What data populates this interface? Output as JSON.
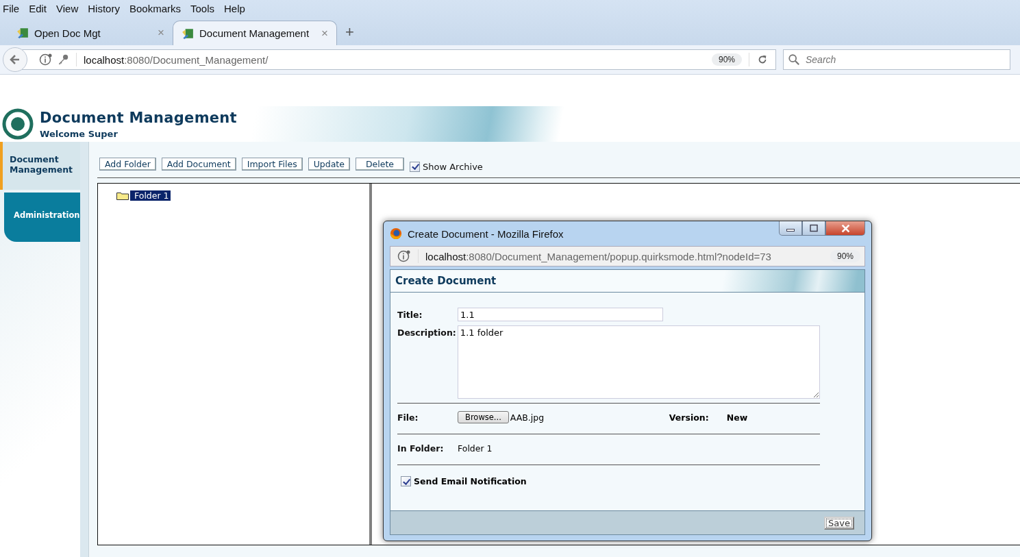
{
  "browser": {
    "menu": [
      "File",
      "Edit",
      "View",
      "History",
      "Bookmarks",
      "Tools",
      "Help"
    ],
    "tabs": [
      {
        "label": "Open Doc Mgt",
        "selected": false,
        "close": "×"
      },
      {
        "label": "Document Management",
        "selected": true,
        "close": "×"
      }
    ],
    "new_tab": "+",
    "address": {
      "host": "localhost",
      "path": ":8080/Document_Management/",
      "zoom": "90%"
    },
    "search": {
      "placeholder": "Search"
    }
  },
  "header": {
    "title": "Document Management",
    "welcome": "Welcome Super"
  },
  "sidebar": {
    "items": [
      {
        "label": "Document Management",
        "selected": true
      },
      {
        "label": "Administration",
        "selected": false
      }
    ]
  },
  "toolbar": {
    "buttons": [
      "Add Folder",
      "Add Document",
      "Import Files",
      "Update",
      "Delete"
    ],
    "show_archive": {
      "label": "Show Archive",
      "checked": true
    }
  },
  "tree": {
    "items": [
      {
        "label": "Folder 1",
        "selected": true
      }
    ]
  },
  "popup": {
    "title": "Create Document - Mozilla Firefox",
    "address": {
      "host": "localhost",
      "path": ":8080/Document_Management/popup.quirksmode.html?nodeId=73",
      "zoom": "90%"
    },
    "heading": "Create Document",
    "title_label": "Title:",
    "title_value": "1.1",
    "description_label": "Description:",
    "description_value": "1.1 folder",
    "file_label": "File:",
    "browse": "Browse...",
    "file_name": "AAB.jpg",
    "version_label": "Version:",
    "version_value": "New",
    "folder_label": "In Folder:",
    "folder_value": "Folder 1",
    "notify": {
      "label": "Send Email Notification",
      "checked": true
    },
    "save": "Save"
  }
}
